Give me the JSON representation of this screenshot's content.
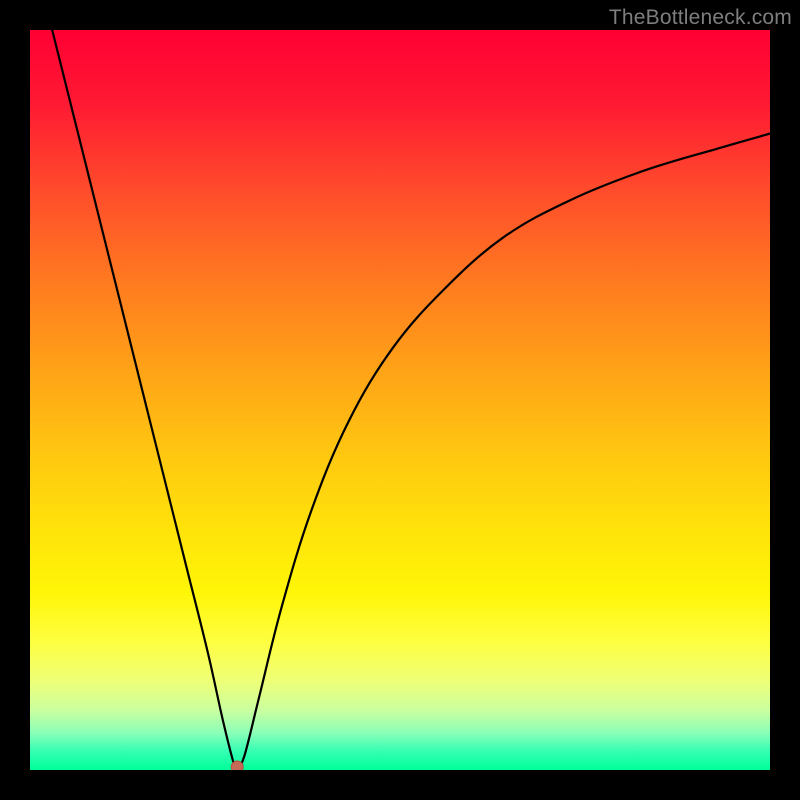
{
  "watermark": "TheBottleneck.com",
  "chart_data": {
    "type": "line",
    "title": "",
    "xlabel": "",
    "ylabel": "",
    "xlim": [
      0,
      100
    ],
    "ylim": [
      0,
      100
    ],
    "grid": false,
    "legend": false,
    "background_gradient": {
      "top_color": "#ff0033",
      "bottom_color": "#00ff99",
      "meaning": "red (high bottleneck) to green (no bottleneck)"
    },
    "min_point": {
      "x": 28,
      "y": 0,
      "marker_color": "#c46a56"
    },
    "series": [
      {
        "name": "bottleneck-curve-left",
        "x": [
          3,
          6,
          9,
          12,
          15,
          18,
          21,
          24,
          26,
          27.5,
          28
        ],
        "y": [
          100,
          88,
          76,
          64,
          52,
          40,
          28,
          16,
          7,
          1,
          0
        ]
      },
      {
        "name": "bottleneck-curve-right",
        "x": [
          28,
          29,
          31,
          34,
          38,
          43,
          49,
          56,
          64,
          73,
          83,
          93,
          100
        ],
        "y": [
          0,
          2,
          10,
          22,
          35,
          47,
          57,
          65,
          72,
          77,
          81,
          84,
          86
        ]
      }
    ]
  }
}
